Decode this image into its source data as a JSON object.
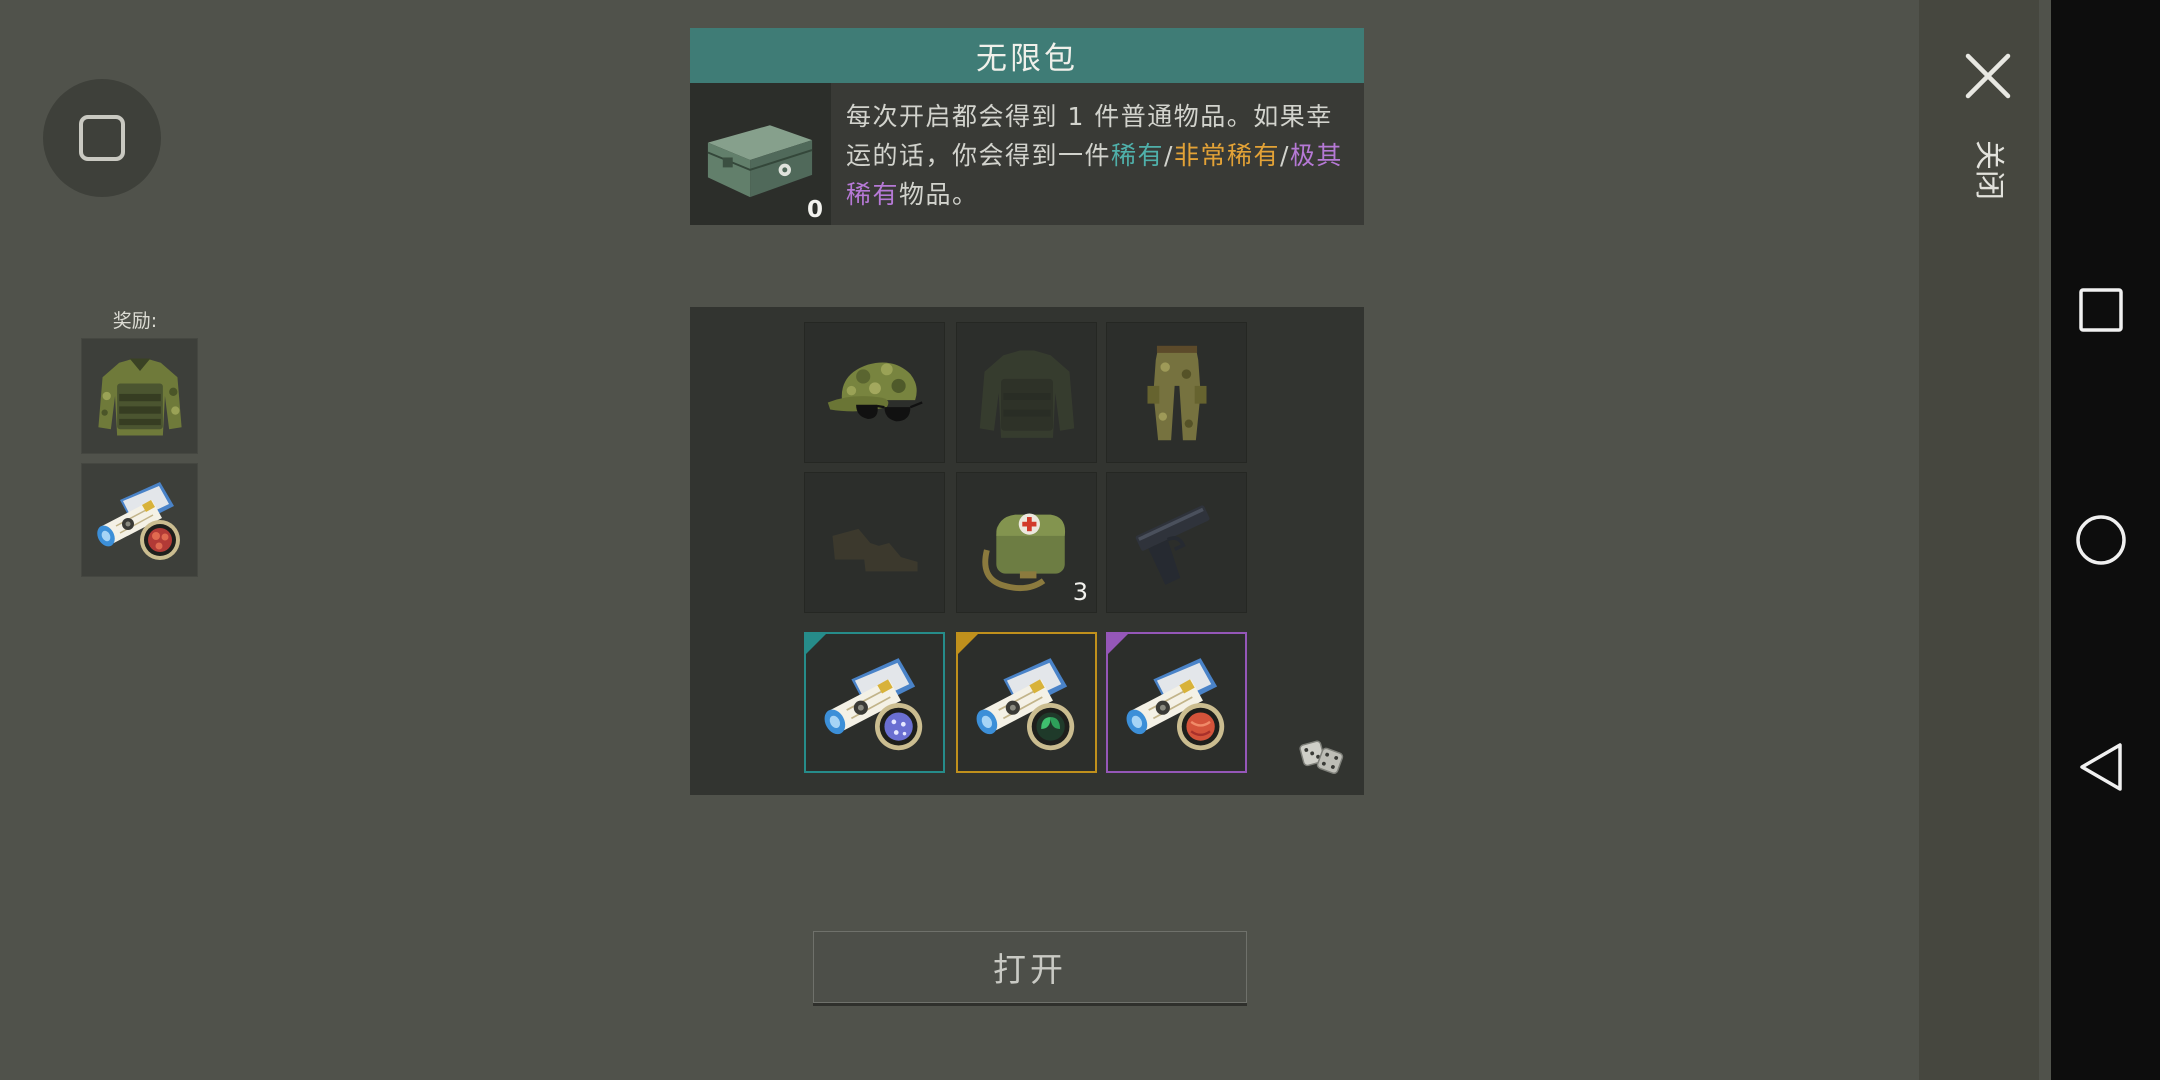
{
  "menu_button": {
    "icon": "rounded-square-icon"
  },
  "header": {
    "title": "无限包"
  },
  "crate": {
    "icon": "supply-crate",
    "count": "0"
  },
  "description": {
    "intro": "每次开启都会得到 1 件普通物品。如果幸运的话，你会得到一件",
    "rare": "稀有",
    "separator": "/",
    "very_rare": "非常稀有",
    "epic": "极其稀有",
    "outro": "物品。"
  },
  "rewards": {
    "label": "奖励:",
    "items": [
      {
        "icon": "camo-jacket"
      },
      {
        "icon": "blueprint-red-badge"
      }
    ]
  },
  "grid": {
    "items": [
      {
        "icon": "camo-cap-with-sunglasses",
        "count": "",
        "dimmed": false
      },
      {
        "icon": "tactical-vest",
        "count": "",
        "dimmed": true
      },
      {
        "icon": "camo-pants",
        "count": "",
        "dimmed": false
      },
      {
        "icon": "boots",
        "count": "",
        "dimmed": true
      },
      {
        "icon": "medkit-bag",
        "count": "3",
        "dimmed": false
      },
      {
        "icon": "pistol",
        "count": "",
        "dimmed": false
      },
      {
        "icon": "blueprint-blue-badge",
        "count": "",
        "rarity": "rare",
        "dimmed": false
      },
      {
        "icon": "blueprint-green-badge",
        "count": "",
        "rarity": "very_rare",
        "dimmed": false
      },
      {
        "icon": "blueprint-red-badge",
        "count": "",
        "rarity": "epic",
        "dimmed": false
      }
    ],
    "reroll_icon": "dice-icon"
  },
  "actions": {
    "open_label": "打开",
    "close_label": "关闭",
    "close_icon": "close-x-icon"
  },
  "nav_bar": {
    "icons": [
      "recents-square-icon",
      "home-circle-icon",
      "back-triangle-icon"
    ]
  },
  "colors": {
    "title_bar": "#3f7c76",
    "text": "#d2d3cd",
    "rare": "#4fb0aa",
    "very_rare": "#e3a236",
    "epic": "#b679d6",
    "rare_border": "#268c8a",
    "very_rare_border": "#c0901c",
    "epic_border": "#9557b8"
  }
}
